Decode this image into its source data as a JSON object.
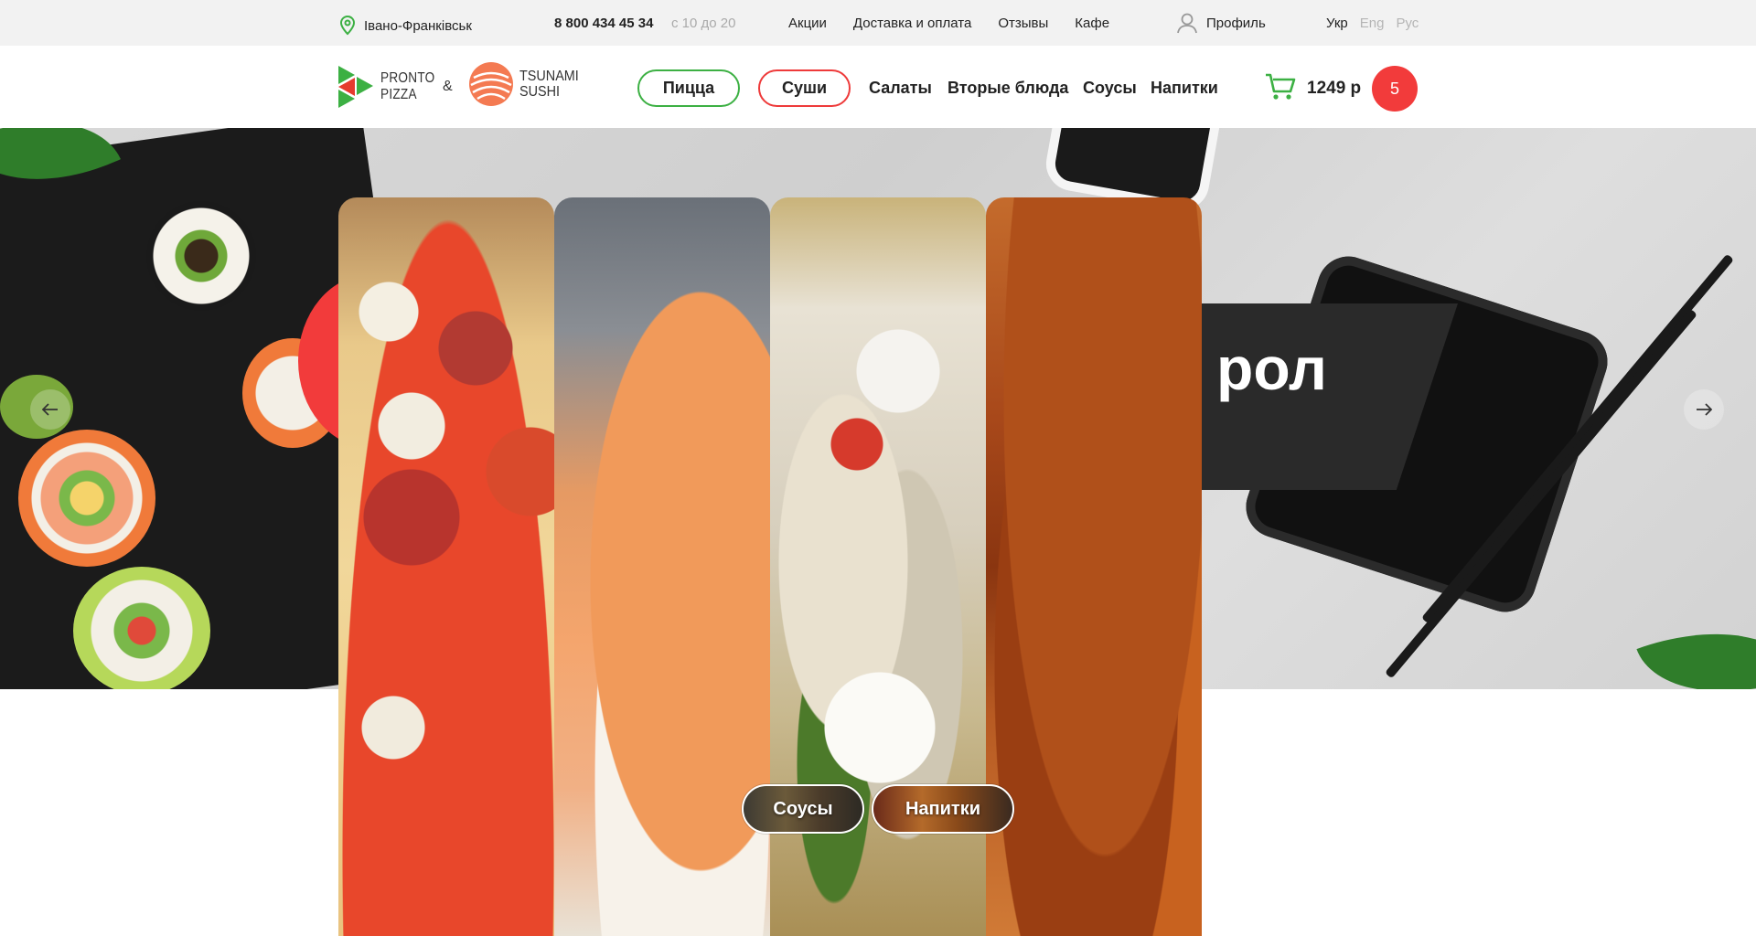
{
  "topbar": {
    "city": "Івано-Франківськ",
    "phone": "8 800 434 45 34",
    "hours": "с 10 до 20",
    "nav": [
      "Акции",
      "Доставка и оплата",
      "Отзывы",
      "Кафе"
    ],
    "profile": "Профиль",
    "languages": {
      "ukr": "Укр",
      "eng": "Eng",
      "rus": "Рус"
    }
  },
  "header": {
    "logo1": {
      "line1": "PRONTO",
      "line2": "PIZZA"
    },
    "amp": "&",
    "logo2": {
      "line1": "TSUNAMI",
      "line2": "SUSHI"
    },
    "pill_pizza": "Пицца",
    "pill_sushi": "Суши",
    "categories": [
      "Салаты",
      "Вторые блюда",
      "Соусы",
      "Напитки"
    ],
    "cart_sum": "1249 р",
    "cart_count": "5"
  },
  "hero": {
    "banner_text": "рол"
  },
  "chips": {
    "sauces": "Соусы",
    "drinks": "Напитки"
  },
  "colors": {
    "accent_green": "#3cb043",
    "accent_red": "#f23b3b",
    "topbar_bg": "#f2f2f2"
  },
  "icons": [
    "location-icon",
    "profile-icon",
    "cart-icon",
    "arrow-left-icon",
    "arrow-right-icon",
    "pronto-pizza-logo",
    "tsunami-sushi-logo"
  ]
}
